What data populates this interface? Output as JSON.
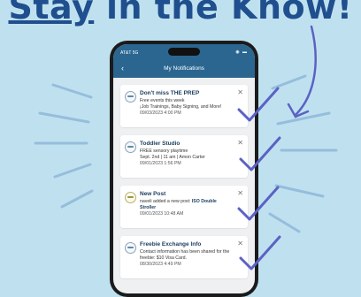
{
  "headline": {
    "text_a": "Stay",
    "text_b": " in the Know!"
  },
  "status_bar": {
    "carrier": "AT&T 5G",
    "indicators": "◉ ▬"
  },
  "nav": {
    "back_icon": "‹",
    "title": "My Notifications"
  },
  "notifications": [
    {
      "title": "Don't miss THE PREP",
      "lines": [
        "Free events this week",
        "¡Job Trainings, Baby Signing, and More!"
      ],
      "date": "09/03/2023 4:00 PM",
      "icon": "org-logo-icon"
    },
    {
      "title": "Toddler Studio",
      "lines": [
        "FREE sensory playtime",
        "Sept. 2nd | 11 am | Amon Carter"
      ],
      "date": "09/01/2023 1:56 PM",
      "icon": "org-logo-icon"
    },
    {
      "title": "New Post",
      "line_a": "naveli added a new post: ",
      "line_a_bold": "ISO Double",
      "line_b_bold": "Stroller",
      "date": "09/01/2023 10:48 AM",
      "icon": "post-icon"
    },
    {
      "title": "Freebie Exchange Info",
      "lines": [
        "Contact information has been shared for the",
        "freebie: $10 Visa Card."
      ],
      "date": "08/30/2023 4:49 PM",
      "icon": "org-logo-icon"
    }
  ],
  "close_icon": "✕",
  "colors": {
    "background": "#bfe1ef",
    "headline": "#1f4f8e",
    "app_bar": "#2a6690",
    "checkmark": "#5b62c4"
  }
}
